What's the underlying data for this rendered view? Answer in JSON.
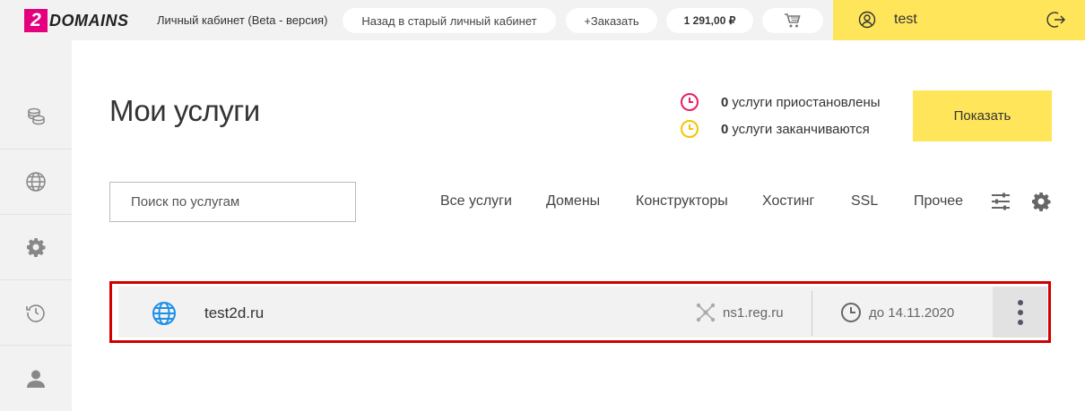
{
  "header": {
    "logo_badge": "2",
    "logo_text": "DOMAINS",
    "cabinet_label": "Личный кабинет (Beta - версия)",
    "back_label": "Назад в старый личный кабинет",
    "order_label": "+Заказать",
    "balance": "1 291,00 ₽",
    "cart_icon": "cart-icon",
    "username": "test",
    "user_icon": "user-circle-icon",
    "logout_icon": "logout-icon",
    "accent_color": "#ffe55a",
    "brand_color": "#e5007e"
  },
  "sidebar": {
    "items": [
      {
        "icon": "coins-icon"
      },
      {
        "icon": "globe-icon"
      },
      {
        "icon": "gear-icon"
      },
      {
        "icon": "history-icon"
      },
      {
        "icon": "user-icon"
      }
    ]
  },
  "main": {
    "title": "Мои услуги",
    "status": {
      "suspended_count": "0",
      "suspended_text": "услуги приостановлены",
      "suspended_color": "#e91e63",
      "expiring_count": "0",
      "expiring_text": "услуги заканчиваются",
      "expiring_color": "#f5c400"
    },
    "show_button": "Показать",
    "search_placeholder": "Поиск по услугам",
    "tabs": [
      {
        "label": "Все услуги"
      },
      {
        "label": "Домены"
      },
      {
        "label": "Конструкторы"
      },
      {
        "label": "Хостинг"
      },
      {
        "label": "SSL"
      },
      {
        "label": "Прочее"
      }
    ],
    "services": [
      {
        "domain": "test2d.ru",
        "nameserver": "ns1.reg.ru",
        "expires": "до 14.11.2020"
      }
    ]
  }
}
